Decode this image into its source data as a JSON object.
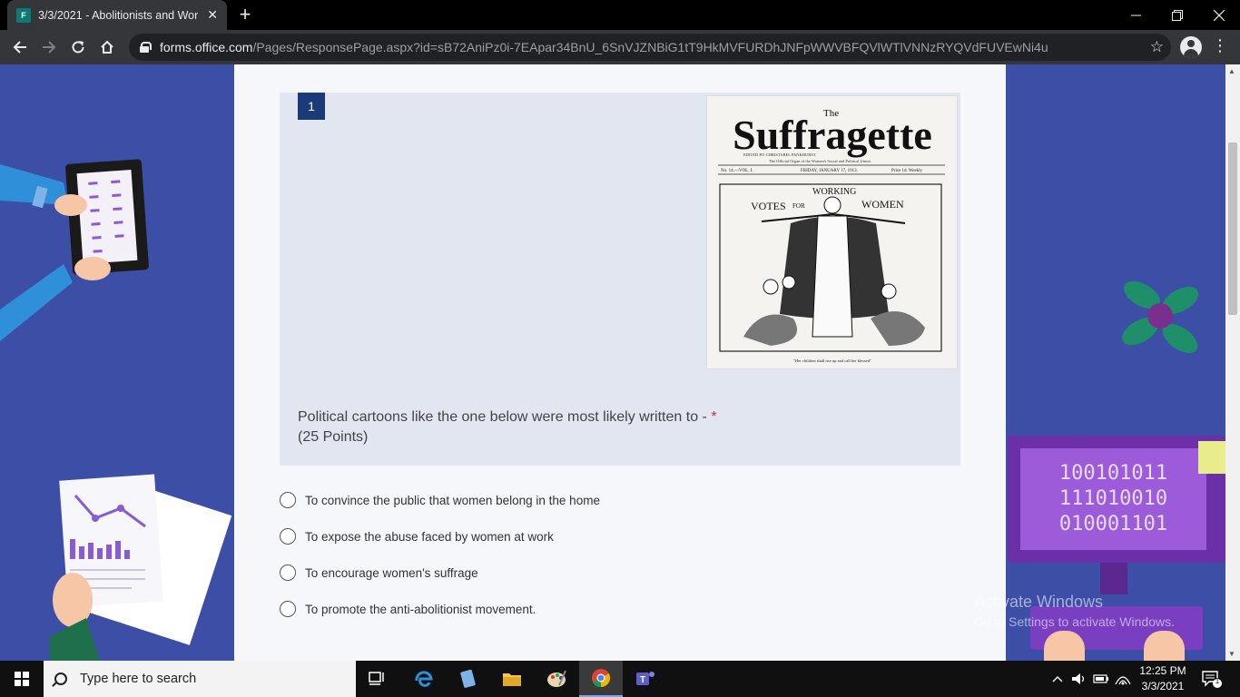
{
  "browser": {
    "tab_favicon": "F",
    "tab_title": "3/3/2021 - Abolitionists and Wor",
    "url_host": "forms.office.com",
    "url_path": "/Pages/ResponsePage.aspx?id=sB72AniPz0i-7EApar34BnU_6SnVJZNBiG1tT9HkMVFURDhJNFpWWVBFQVlWTlVNNzRYQVdFUVEwNi4u"
  },
  "question": {
    "number": "1",
    "text": "Political cartoons like the one below were most likely written to - ",
    "required_mark": "*",
    "points": "(25 Points)"
  },
  "image": {
    "masthead_small": "The",
    "masthead": "Suffragette",
    "subline": "EDITED BY CHRISTABEL PANKHURST.",
    "organ": "The Official Organ of the Women's Social and Political Union.",
    "issue": "No. 14.—VOL. I.",
    "date": "FRIDAY, JANUARY 17, 1913.",
    "price": "Price 1d. Weekly",
    "banner_left": "VOTES",
    "banner_for": "FOR",
    "banner_arc": "WORKING",
    "banner_right": "WOMEN",
    "caption": "\"Her children shall rise up and call her blessed\""
  },
  "options": [
    {
      "label": "To convince the public that women belong in the home"
    },
    {
      "label": "To expose the abuse faced by women at work"
    },
    {
      "label": "To encourage women's suffrage"
    },
    {
      "label": "To promote the anti-abolitionist movement."
    }
  ],
  "watermark": {
    "line1": "Activate Windows",
    "line2": "Go to Settings to activate Windows."
  },
  "decor": {
    "binary": [
      "100101011",
      "111010010",
      "010001101"
    ]
  },
  "taskbar": {
    "search_placeholder": "Type here to search",
    "time": "12:25 PM",
    "date": "3/3/2021",
    "notification_count": "1"
  },
  "colors": {
    "page_background": "#3d4ea6",
    "question_number_bg": "#1b3a78",
    "required": "#c4314b"
  }
}
